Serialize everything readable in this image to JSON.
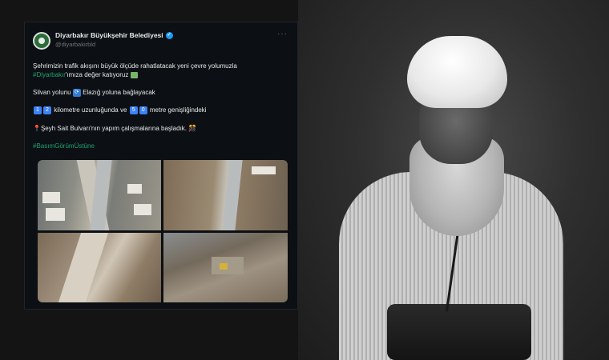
{
  "tweet": {
    "account_name": "Diyarbakır Büyükşehir Belediyesi",
    "handle": "@diyarbakirbld",
    "more_icon": "more-dots-icon",
    "line1": "Şehrimizin trafik akışını büyük ölçüde rahatlatacak yeni çevre yolumuzla",
    "line2_hashtag": "#Diyarbakır",
    "line2_rest": "'ımıza değer katıyoruz",
    "line3_a": "Silvan yolunu",
    "line3_b": "Elazığ yoluna bağlayacak",
    "num1_a": "1",
    "num1_b": "2",
    "line4_a": "kilometre uzunluğunda ve",
    "num2_a": "5",
    "num2_b": "0",
    "line4_b": "metre genişliğindeki",
    "line5": "Şeyh Sait Bulvarı'nın yapım çalışmalarına başladık.",
    "hashtag2": "#BasımGörümÜstüne",
    "verified_color": "#1d9bf0",
    "hashtag_color": "#1d9bf0"
  },
  "photos": [
    "road-construction-aerial-1",
    "road-construction-aerial-2",
    "road-construction-aerial-3",
    "road-construction-aerial-4"
  ],
  "portrait": "historical-portrait-man-white-turban"
}
